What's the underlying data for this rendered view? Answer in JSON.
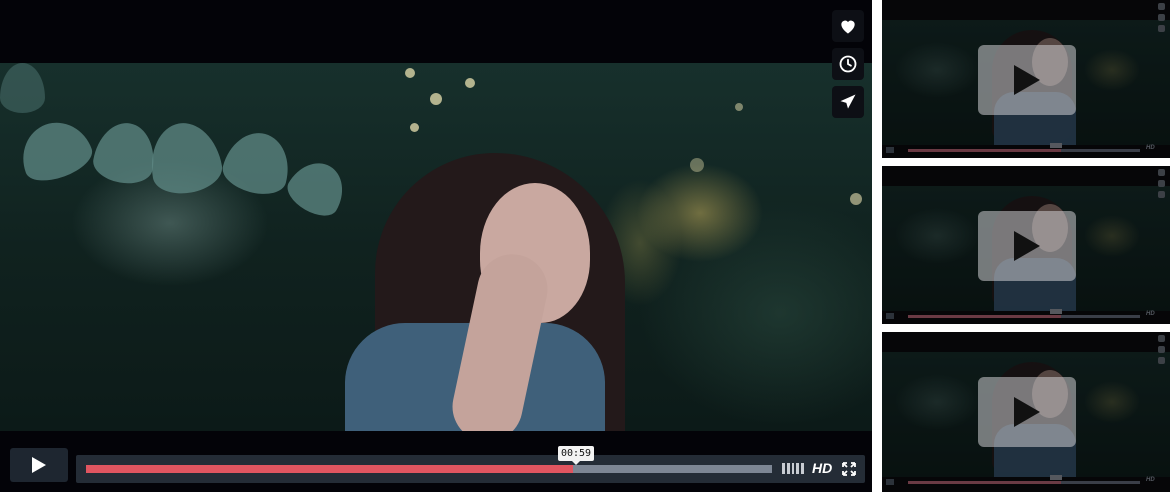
{
  "player": {
    "current_time": "00:59",
    "progress": 0.71,
    "hd_label": "HD",
    "accent_color": "#e05560"
  },
  "icons": {
    "like": "heart-icon",
    "watch_later": "clock-icon",
    "share": "send-icon",
    "play": "play-icon",
    "volume": "volume-bars-icon",
    "fullscreen": "fullscreen-icon"
  },
  "thumbnails": [
    {
      "progress": 0.66,
      "hd_label": "HD"
    },
    {
      "progress": 0.66,
      "hd_label": "HD"
    },
    {
      "progress": 0.66,
      "hd_label": "HD"
    }
  ]
}
